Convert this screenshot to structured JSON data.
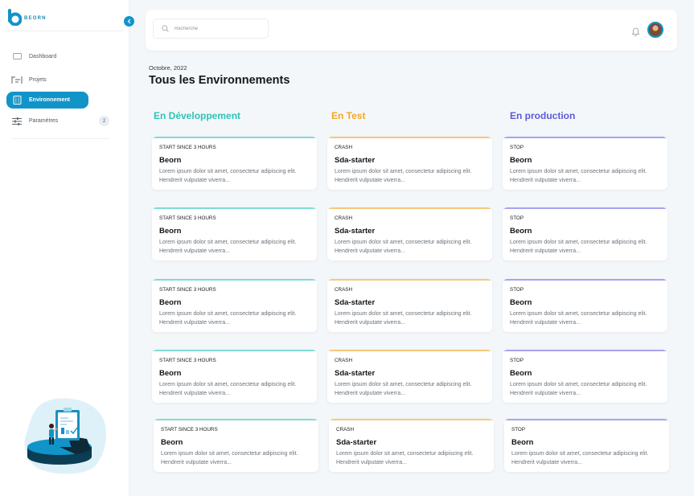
{
  "app": {
    "logo_text": "BEORN",
    "brand_color": "#1194c8"
  },
  "sidebar": {
    "items": [
      {
        "label": "Dashboard",
        "icon": "monitor-icon",
        "active": false
      },
      {
        "label": "Projets",
        "icon": "projects-icon",
        "active": false
      },
      {
        "label": "Environnement",
        "icon": "building-icon",
        "active": true
      },
      {
        "label": "Paramètres",
        "icon": "sliders-icon",
        "active": false,
        "badge": "2"
      }
    ]
  },
  "header": {
    "search_placeholder": "Recherche",
    "notification_icon": "bell-icon",
    "avatar_icon": "user-avatar"
  },
  "main": {
    "date": "Octobre, 2022",
    "title": "Tous les Environnements",
    "columns": [
      {
        "title": "En Développement",
        "color": "#2ec4b6",
        "accent": "#7fdbd3",
        "cards": [
          {
            "status": "START SINCE  3 HOURS",
            "name": "Beorn",
            "desc": "Lorem ipsum dolor sit amet, consectetur adipiscing elit. Hendrerit vulputate viverra..."
          },
          {
            "status": "START SINCE  3 HOURS",
            "name": "Beorn",
            "desc": "Lorem ipsum dolor sit amet, consectetur adipiscing elit. Hendrerit vulputate viverra..."
          },
          {
            "status": "START SINCE  3 HOURS",
            "name": "Beorn",
            "desc": "Lorem ipsum dolor sit amet, consectetur adipiscing elit. Hendrerit vulputate viverra..."
          },
          {
            "status": "START SINCE  3 HOURS",
            "name": "Beorn",
            "desc": "Lorem ipsum dolor sit amet, consectetur adipiscing elit. Hendrerit vulputate viverra..."
          },
          {
            "status": "START SINCE  3 HOURS",
            "name": "Beorn",
            "desc": "Lorem ipsum dolor sit amet, consectetur adipiscing elit. Hendrerit vulputate viverra..."
          }
        ]
      },
      {
        "title": "En Test",
        "color": "#f5a623",
        "accent": "#f7c77a",
        "cards": [
          {
            "status": "CRASH",
            "name": "Sda-starter",
            "desc": "Lorem ipsum dolor sit amet, consectetur adipiscing elit. Hendrerit vulputate viverra..."
          },
          {
            "status": "CRASH",
            "name": "Sda-starter",
            "desc": "Lorem ipsum dolor sit amet, consectetur adipiscing elit. Hendrerit vulputate viverra..."
          },
          {
            "status": "CRASH",
            "name": "Sda-starter",
            "desc": "Lorem ipsum dolor sit amet, consectetur adipiscing elit. Hendrerit vulputate viverra..."
          },
          {
            "status": "CRASH",
            "name": "Sda-starter",
            "desc": "Lorem ipsum dolor sit amet, consectetur adipiscing elit. Hendrerit vulputate viverra..."
          },
          {
            "status": "CRASH",
            "name": "Sda-starter",
            "desc": "Lorem ipsum dolor sit amet, consectetur adipiscing elit. Hendrerit vulputate viverra..."
          }
        ]
      },
      {
        "title": "En production",
        "color": "#5b5bd6",
        "accent": "#a7a3ee",
        "cards": [
          {
            "status": "STOP",
            "name": "Beorn",
            "desc": "Lorem ipsum dolor sit amet, consectetur adipiscing elit. Hendrerit vulputate viverra..."
          },
          {
            "status": "STOP",
            "name": "Beorn",
            "desc": "Lorem ipsum dolor sit amet, consectetur adipiscing elit. Hendrerit vulputate viverra..."
          },
          {
            "status": "STOP",
            "name": "Beorn",
            "desc": "Lorem ipsum dolor sit amet, consectetur adipiscing elit. Hendrerit vulputate viverra..."
          },
          {
            "status": "STOP",
            "name": "Beorn",
            "desc": "Lorem ipsum dolor sit amet, consectetur adipiscing elit. Hendrerit vulputate viverra..."
          },
          {
            "status": "STOP",
            "name": "Beorn",
            "desc": "Lorem ipsum dolor sit amet, consectetur adipiscing elit. Hendrerit vulputate viverra..."
          }
        ]
      }
    ]
  }
}
